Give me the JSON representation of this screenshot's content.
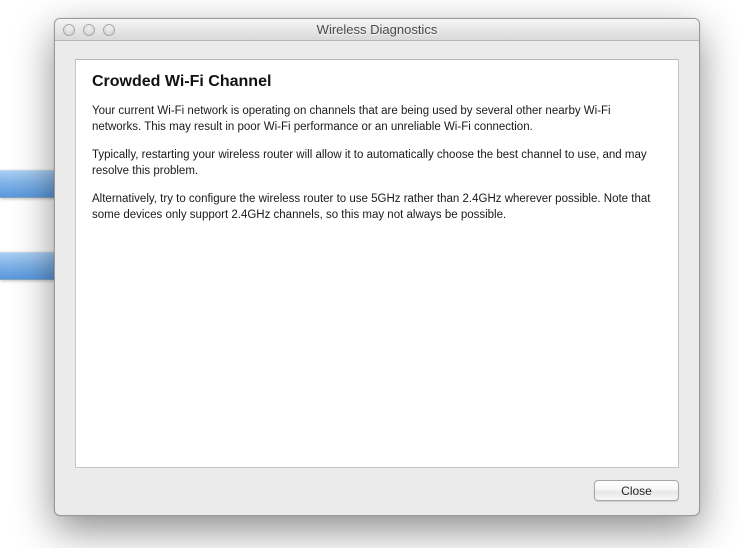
{
  "window": {
    "title": "Wireless Diagnostics"
  },
  "dialog": {
    "heading": "Crowded Wi-Fi Channel",
    "paragraphs": [
      "Your current Wi-Fi network is operating on channels that are being used by several other nearby Wi-Fi networks.  This may result in poor Wi-Fi performance or an unreliable Wi-Fi connection.",
      "Typically, restarting your wireless router will allow it to automatically choose the best channel to use, and may resolve this problem.",
      "Alternatively, try to configure the wireless router to use 5GHz rather than 2.4GHz wherever possible.  Note that some devices only support 2.4GHz channels, so this may not always be possible."
    ]
  },
  "buttons": {
    "close": "Close"
  }
}
